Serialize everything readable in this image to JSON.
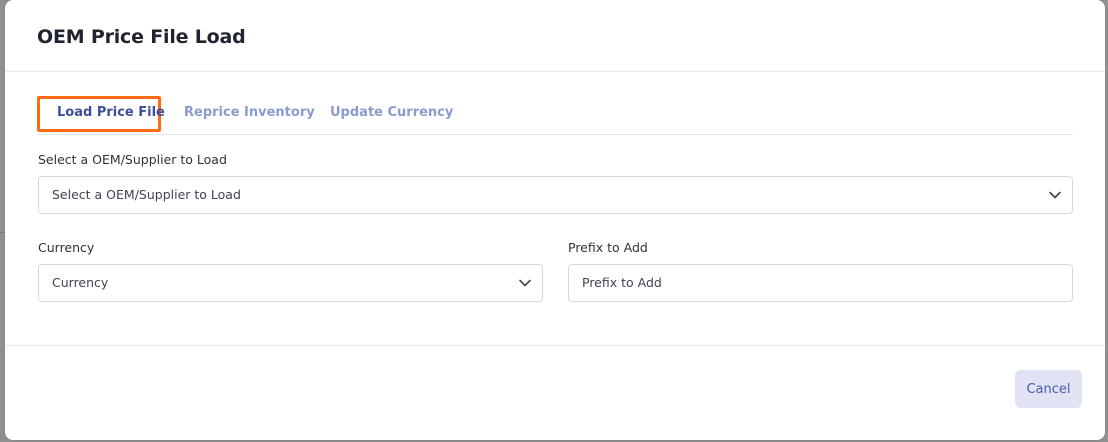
{
  "modal": {
    "title": "OEM Price File Load"
  },
  "tabs": [
    {
      "label": "Load Price File",
      "active": true
    },
    {
      "label": "Reprice Inventory",
      "active": false
    },
    {
      "label": "Update Currency",
      "active": false
    }
  ],
  "form": {
    "supplier": {
      "label": "Select a OEM/Supplier to Load",
      "selected": "Select a OEM/Supplier to Load"
    },
    "currency": {
      "label": "Currency",
      "selected": "Currency"
    },
    "prefix": {
      "label": "Prefix to Add",
      "placeholder": "Prefix to Add"
    }
  },
  "footer": {
    "cancel_label": "Cancel"
  },
  "colors": {
    "active_tab": "#3d4f9c",
    "inactive_tab": "#8a9bd0",
    "highlight": "#ff6a13",
    "cancel_bg": "#dfe3f3"
  },
  "icons": {
    "dropdown": "chevron-down-icon"
  }
}
